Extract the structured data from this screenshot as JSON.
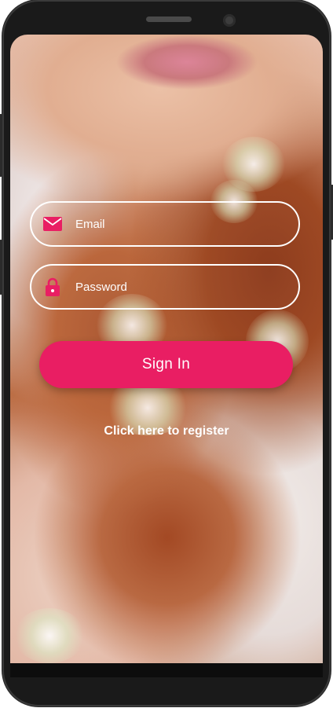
{
  "login": {
    "email_placeholder": "Email",
    "password_placeholder": "Password",
    "signin_label": "Sign In",
    "register_link": "Click here to register"
  },
  "icons": {
    "email": "envelope-icon",
    "password": "lock-icon"
  },
  "colors": {
    "accent": "#e91e63",
    "text": "#ffffff",
    "phone_frame": "#1a1a1a"
  }
}
